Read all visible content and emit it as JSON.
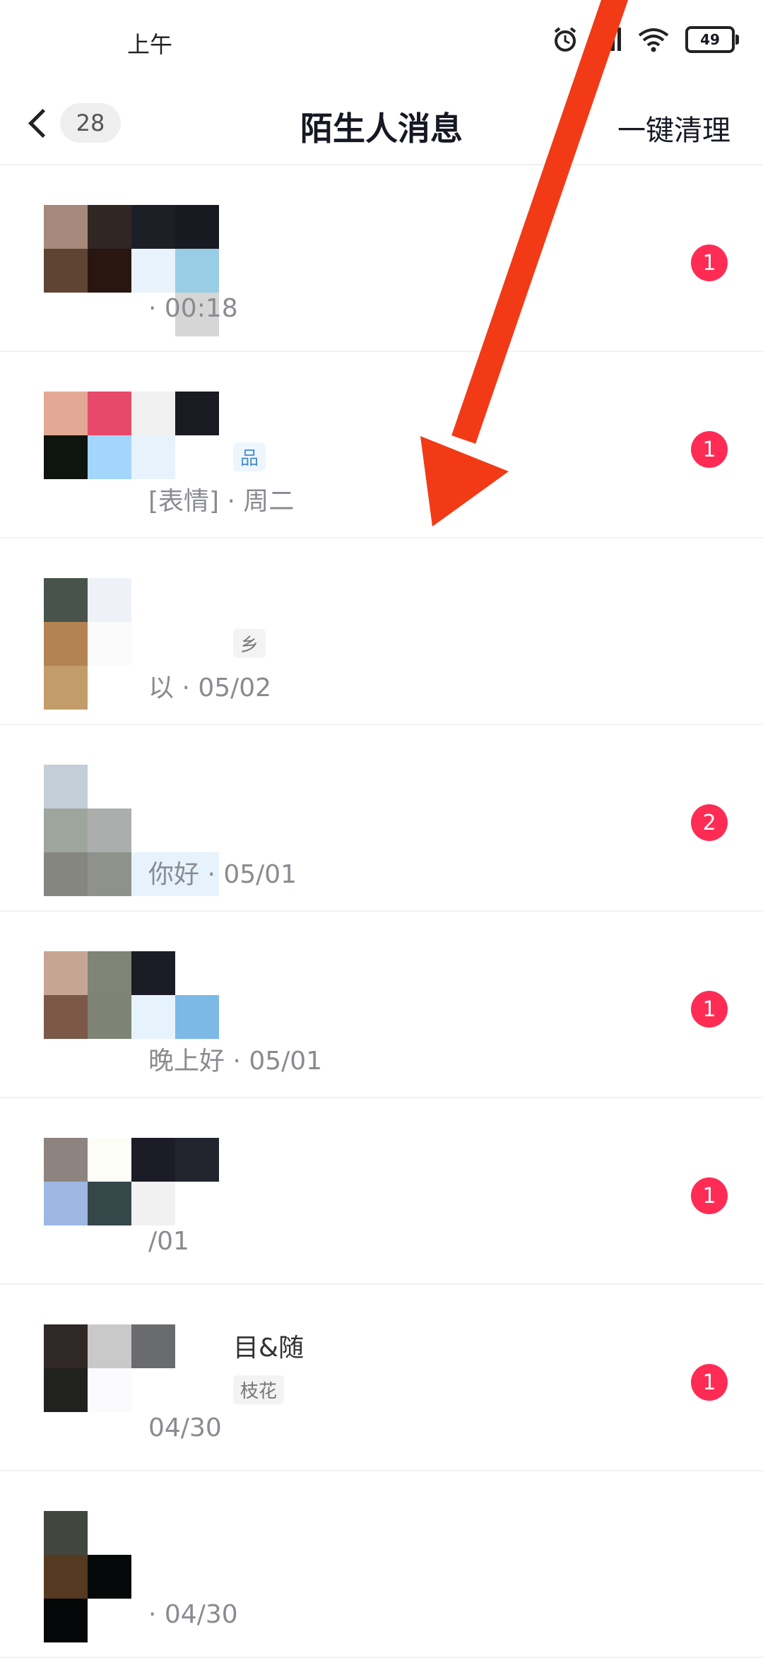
{
  "status_bar": {
    "time": "上午",
    "battery": "49"
  },
  "header": {
    "back_count": "28",
    "title": "陌生人消息",
    "clear_label": "一键清理"
  },
  "conversations": [
    {
      "title": "",
      "tag": "",
      "preview": "· 00:18",
      "badge": "1",
      "avatar": [
        "#a6897a",
        "#302624",
        "#1d1f27",
        "#181a22",
        "#5f4433",
        "#291610",
        "#e8f3fc",
        "#99cde5",
        "#ffffff",
        "#ffffff",
        "#ffffff",
        "#d6d6d6"
      ]
    },
    {
      "title": "",
      "tag": "品",
      "preview": "[表情] · 周二",
      "badge": "1",
      "avatar": [
        "#e3a995",
        "#e7496a",
        "#f0f0f0",
        "#1a1b22",
        "#0d150e",
        "#a4d5fb",
        "#e6f3fd",
        "#ffffff",
        "#ffffff",
        "#ffffff",
        "#ffffff",
        "#ffffff"
      ]
    },
    {
      "title": "",
      "tag": "乡",
      "preview": "以 · 05/02",
      "badge": "",
      "avatar": [
        "#48534c",
        "#eef2f8",
        "#ffffff",
        "#ffffff",
        "#b38352",
        "#fbfbfb",
        "#ffffff",
        "#ffffff",
        "#c29c6a",
        "#ffffff",
        "#ffffff",
        "#ffffff"
      ]
    },
    {
      "title": "",
      "tag": "",
      "preview": "你好 · 05/01",
      "badge": "2",
      "avatar": [
        "#c4ced8",
        "#ffffff",
        "#ffffff",
        "#ffffff",
        "#9ea59d",
        "#acaeae",
        "#ffffff",
        "#ffffff",
        "#858680",
        "#8f918b",
        "#e6f3fd",
        "#e6f3fd"
      ]
    },
    {
      "title": "",
      "tag": "",
      "preview": "晚上好 · 05/01",
      "badge": "1",
      "avatar": [
        "#c7a594",
        "#7f8474",
        "#1b1c26",
        "#ffffff",
        "#7b5847",
        "#7e8373",
        "#e6f3fd",
        "#7cb9e6",
        "#ffffff",
        "#ffffff",
        "#ffffff",
        "#ffffff"
      ]
    },
    {
      "title": "",
      "tag": "",
      "preview": "/01",
      "badge": "1",
      "avatar": [
        "#8d8480",
        "#fdfdf8",
        "#1b1c26",
        "#22252d",
        "#9fb8e3",
        "#36474a",
        "#f1f1f1",
        "#ffffff",
        "#ffffff",
        "#ffffff",
        "#ffffff",
        "#ffffff"
      ]
    },
    {
      "title": "目&随",
      "tag": "枝花",
      "preview": "04/30",
      "badge": "1",
      "avatar": [
        "#302826",
        "#c9c9c9",
        "#6a6b6f",
        "#ffffff",
        "#21221f",
        "#fbfbfd",
        "#ffffff",
        "#ffffff",
        "#ffffff",
        "#ffffff",
        "#ffffff",
        "#ffffff"
      ]
    },
    {
      "title": "",
      "tag": "",
      "preview": "· 04/30",
      "badge": "",
      "avatar": [
        "#41463f",
        "#ffffff",
        "#ffffff",
        "#ffffff",
        "#553920",
        "#050909",
        "#ffffff",
        "#ffffff",
        "#040808",
        "#ffffff",
        "#ffffff",
        "#ffffff"
      ]
    }
  ],
  "colors": {
    "badge": "#fe2c55",
    "arrow": "#f23a17"
  }
}
